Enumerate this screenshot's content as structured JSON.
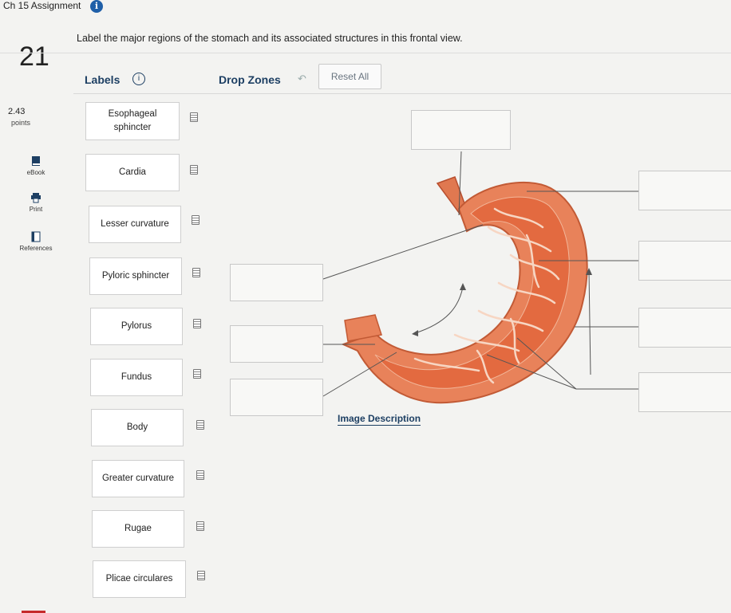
{
  "header": {
    "assignment_title": "Ch 15 Assignment",
    "info_badge": "i",
    "question_number": "21",
    "prompt": "Label the major regions of the stomach and its associated structures in this frontal view."
  },
  "left_rail": {
    "points_value": "2.43",
    "points_label": "points",
    "items": [
      {
        "label": "eBook",
        "icon": "book-icon"
      },
      {
        "label": "Print",
        "icon": "print-icon"
      },
      {
        "label": "References",
        "icon": "references-icon"
      }
    ]
  },
  "toolbar": {
    "labels_heading": "Labels",
    "labels_info": "i",
    "drop_zones_heading": "Drop Zones",
    "undo_icon": "↶",
    "reset_label": "Reset All"
  },
  "labels": [
    {
      "text": "Esophageal sphincter"
    },
    {
      "text": "Cardia"
    },
    {
      "text": "Lesser curvature"
    },
    {
      "text": "Pyloric sphincter"
    },
    {
      "text": "Pylorus"
    },
    {
      "text": "Fundus"
    },
    {
      "text": "Body"
    },
    {
      "text": "Greater curvature"
    },
    {
      "text": "Rugae"
    },
    {
      "text": "Plicae circulares"
    }
  ],
  "diagram": {
    "image_description_link": "Image Description",
    "colors": {
      "stomach_outer": "#e8825a",
      "stomach_inner": "#e0693f",
      "rugae_highlight": "#f6d3c0",
      "leader_line": "#555555"
    }
  }
}
